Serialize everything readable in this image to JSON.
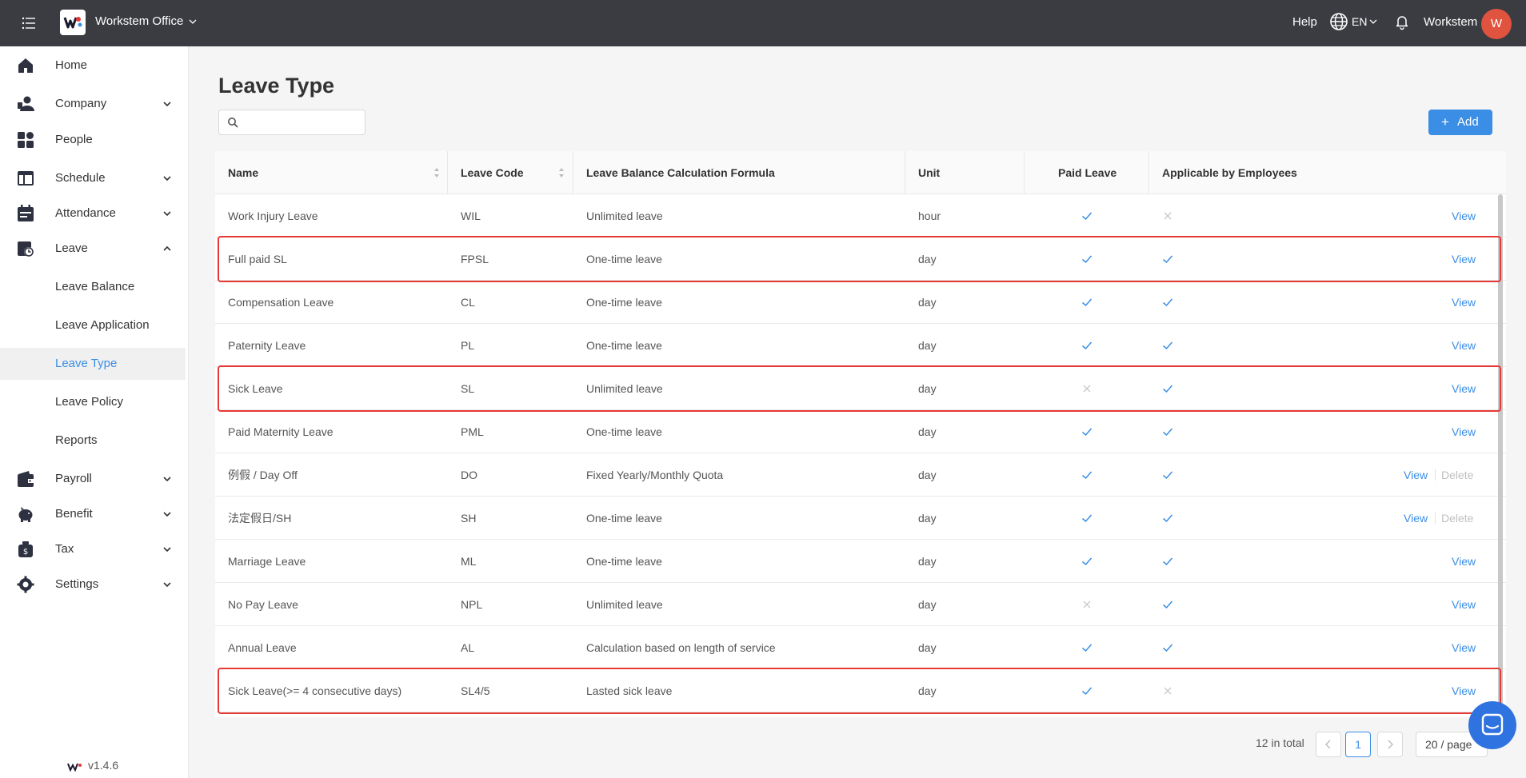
{
  "topbar": {
    "app_name": "Workstem Office",
    "help": "Help",
    "lang": "EN",
    "user_name": "Workstem",
    "avatar_initial": "W",
    "avatar_color": "#e0533e",
    "bar_color": "#3a3c41"
  },
  "sidebar": {
    "items": [
      {
        "label": "Home",
        "icon": "home-icon"
      },
      {
        "label": "Company",
        "icon": "company-icon"
      },
      {
        "label": "People",
        "icon": "people-icon"
      },
      {
        "label": "Schedule",
        "icon": "schedule-icon"
      },
      {
        "label": "Attendance",
        "icon": "attendance-icon"
      },
      {
        "label": "Leave",
        "icon": "leave-icon"
      },
      {
        "label": "Payroll",
        "icon": "payroll-icon"
      },
      {
        "label": "Benefit",
        "icon": "benefit-icon"
      },
      {
        "label": "Tax",
        "icon": "tax-icon"
      },
      {
        "label": "Settings",
        "icon": "settings-icon"
      }
    ],
    "leave_sub": [
      {
        "label": "Leave Balance"
      },
      {
        "label": "Leave Application"
      },
      {
        "label": "Leave Type"
      },
      {
        "label": "Leave Policy"
      },
      {
        "label": "Reports"
      }
    ],
    "version": "v1.4.6"
  },
  "main": {
    "title": "Leave Type",
    "search_placeholder": "",
    "add_label": "Add",
    "accent_color": "#3a8ee6"
  },
  "table": {
    "columns": [
      "Name",
      "Leave Code",
      "Leave Balance Calculation Formula",
      "Unit",
      "Paid Leave",
      "Applicable by Employees"
    ],
    "rows": [
      {
        "name": "Work Injury Leave",
        "code": "WIL",
        "formula": "Unlimited leave",
        "unit": "hour",
        "paid": true,
        "applicable": false,
        "view": "View",
        "delete": ""
      },
      {
        "name": "Full paid SL",
        "code": "FPSL",
        "formula": "One-time leave",
        "unit": "day",
        "paid": true,
        "applicable": true,
        "view": "View",
        "delete": ""
      },
      {
        "name": "Compensation Leave",
        "code": "CL",
        "formula": "One-time leave",
        "unit": "day",
        "paid": true,
        "applicable": true,
        "view": "View",
        "delete": ""
      },
      {
        "name": "Paternity Leave",
        "code": "PL",
        "formula": "One-time leave",
        "unit": "day",
        "paid": true,
        "applicable": true,
        "view": "View",
        "delete": ""
      },
      {
        "name": "Sick Leave",
        "code": "SL",
        "formula": "Unlimited leave",
        "unit": "day",
        "paid": false,
        "applicable": true,
        "view": "View",
        "delete": ""
      },
      {
        "name": "Paid Maternity Leave",
        "code": "PML",
        "formula": "One-time leave",
        "unit": "day",
        "paid": true,
        "applicable": true,
        "view": "View",
        "delete": ""
      },
      {
        "name": "例假 / Day Off",
        "code": "DO",
        "formula": "Fixed Yearly/Monthly Quota",
        "unit": "day",
        "paid": true,
        "applicable": true,
        "view": "View",
        "delete": "Delete"
      },
      {
        "name": "法定假日/SH",
        "code": "SH",
        "formula": "One-time leave",
        "unit": "day",
        "paid": true,
        "applicable": true,
        "view": "View",
        "delete": "Delete"
      },
      {
        "name": "Marriage Leave",
        "code": "ML",
        "formula": "One-time leave",
        "unit": "day",
        "paid": true,
        "applicable": true,
        "view": "View",
        "delete": ""
      },
      {
        "name": "No Pay Leave",
        "code": "NPL",
        "formula": "Unlimited leave",
        "unit": "day",
        "paid": false,
        "applicable": true,
        "view": "View",
        "delete": ""
      },
      {
        "name": "Annual Leave",
        "code": "AL",
        "formula": "Calculation based on length of service",
        "unit": "day",
        "paid": true,
        "applicable": true,
        "view": "View",
        "delete": ""
      },
      {
        "name": "Sick Leave(>= 4 consecutive days)",
        "code": "SL4/5",
        "formula": "Lasted sick leave",
        "unit": "day",
        "paid": true,
        "applicable": false,
        "view": "View",
        "delete": ""
      }
    ],
    "highlighted_rows": [
      1,
      4,
      11
    ],
    "highlight_color": "#e53935"
  },
  "pagination": {
    "total_text": "12 in total",
    "current_page": "1",
    "page_size": "20 / page"
  }
}
